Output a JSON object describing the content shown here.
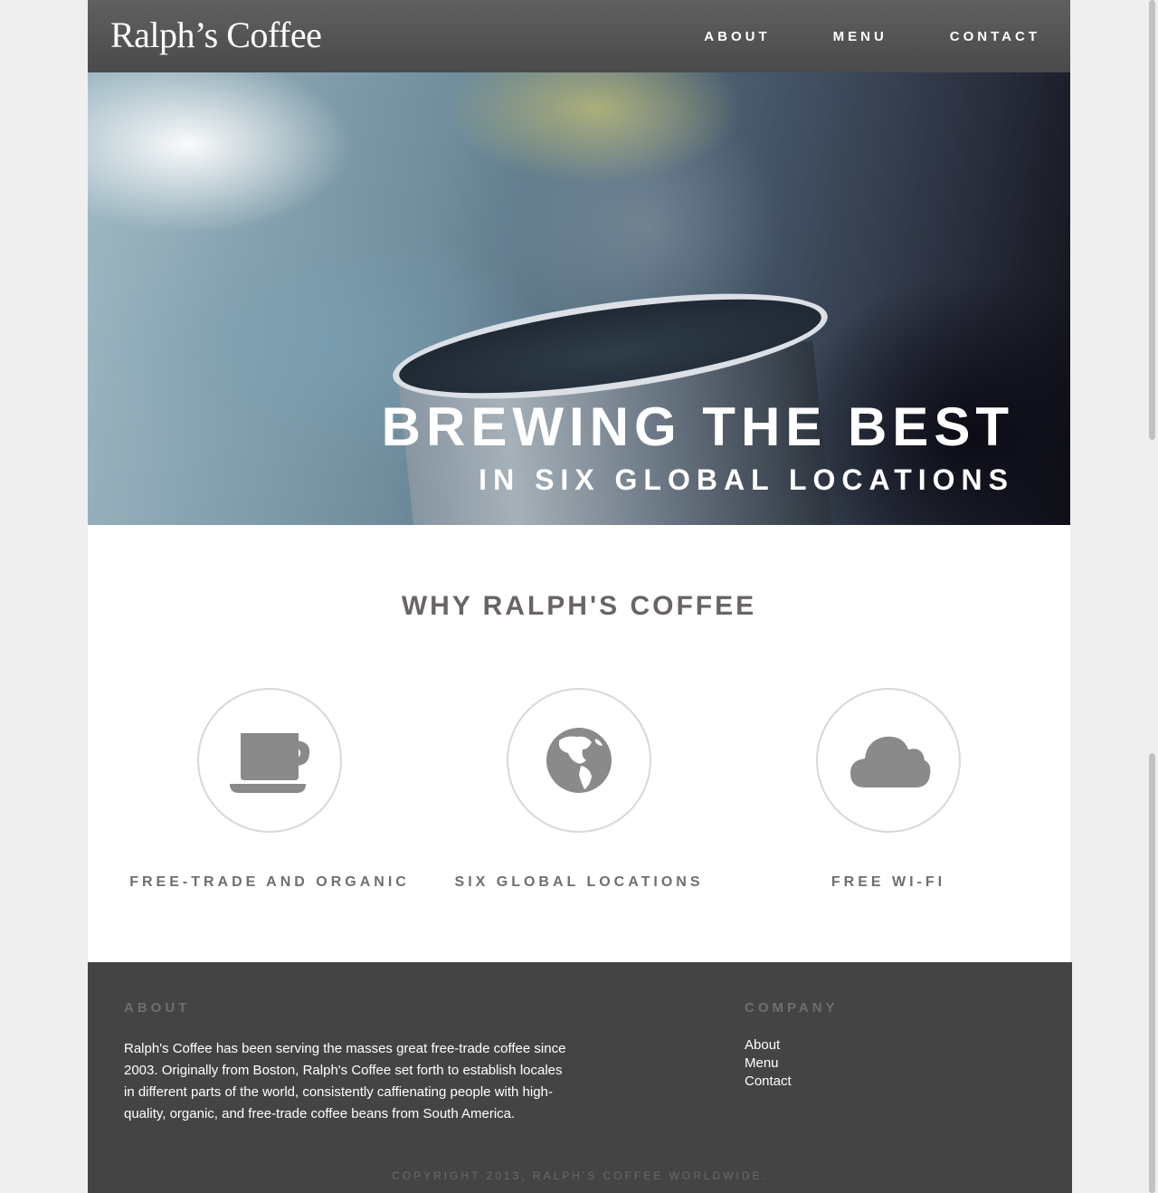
{
  "header": {
    "logo": "Ralph’s Coffee",
    "nav": [
      "ABOUT",
      "MENU",
      "CONTACT"
    ]
  },
  "hero": {
    "title": "BREWING THE BEST",
    "subtitle": "IN SIX GLOBAL LOCATIONS"
  },
  "features": {
    "title": "WHY RALPH'S COFFEE",
    "items": [
      {
        "label": "FREE-TRADE AND ORGANIC",
        "icon": "coffee-cup-icon"
      },
      {
        "label": "SIX GLOBAL LOCATIONS",
        "icon": "globe-icon"
      },
      {
        "label": "FREE WI-FI",
        "icon": "cloud-icon"
      }
    ],
    "icon_color": "#8a8a8a"
  },
  "footer": {
    "about_heading": "ABOUT",
    "about_text": "Ralph's Coffee has been serving the masses great free-trade coffee since 2003. Originally from Boston, Ralph's Coffee set forth to establish locales in different parts of the world, consistently caffienating people with high-quality, organic, and free-trade coffee beans from South America.",
    "company_heading": "COMPANY",
    "links": [
      "About",
      "Menu",
      "Contact"
    ],
    "copyright": "COPYRIGHT 2013, RALPH'S COFFEE WORLDWIDE."
  },
  "colors": {
    "header_bg": "#555555",
    "footer_bg": "#444444",
    "heading_text": "#6a6464",
    "page_bg": "#efefef"
  }
}
